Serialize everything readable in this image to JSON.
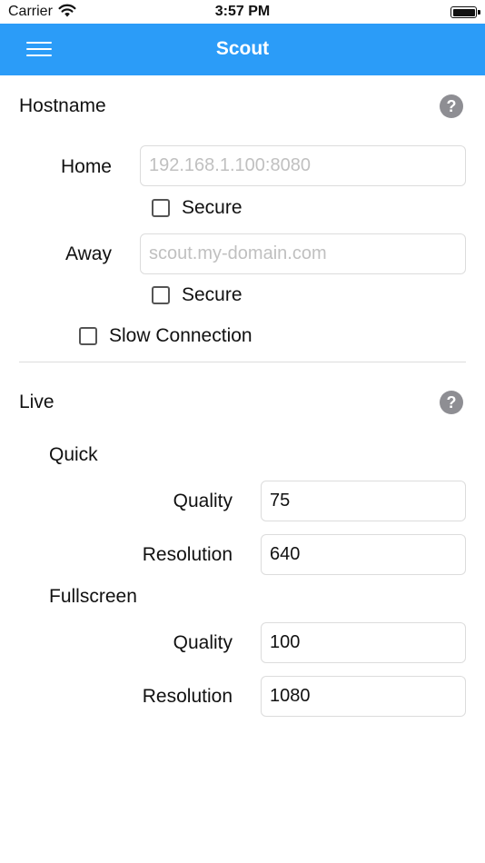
{
  "status_bar": {
    "carrier": "Carrier",
    "time": "3:57 PM"
  },
  "navbar": {
    "title": "Scout"
  },
  "hostname": {
    "title": "Hostname",
    "help": "?",
    "home": {
      "label": "Home",
      "placeholder": "192.168.1.100:8080",
      "value": "",
      "secure_label": "Secure"
    },
    "away": {
      "label": "Away",
      "placeholder": "scout.my-domain.com",
      "value": "",
      "secure_label": "Secure"
    },
    "slow_connection_label": "Slow Connection"
  },
  "live": {
    "title": "Live",
    "help": "?",
    "quick": {
      "label": "Quick",
      "quality_label": "Quality",
      "quality_value": "75",
      "resolution_label": "Resolution",
      "resolution_value": "640"
    },
    "fullscreen": {
      "label": "Fullscreen",
      "quality_label": "Quality",
      "quality_value": "100",
      "resolution_label": "Resolution",
      "resolution_value": "1080"
    }
  },
  "colors": {
    "accent": "#2b9cf8",
    "help_icon": "#8e8e93",
    "divider": "#dddddd"
  }
}
